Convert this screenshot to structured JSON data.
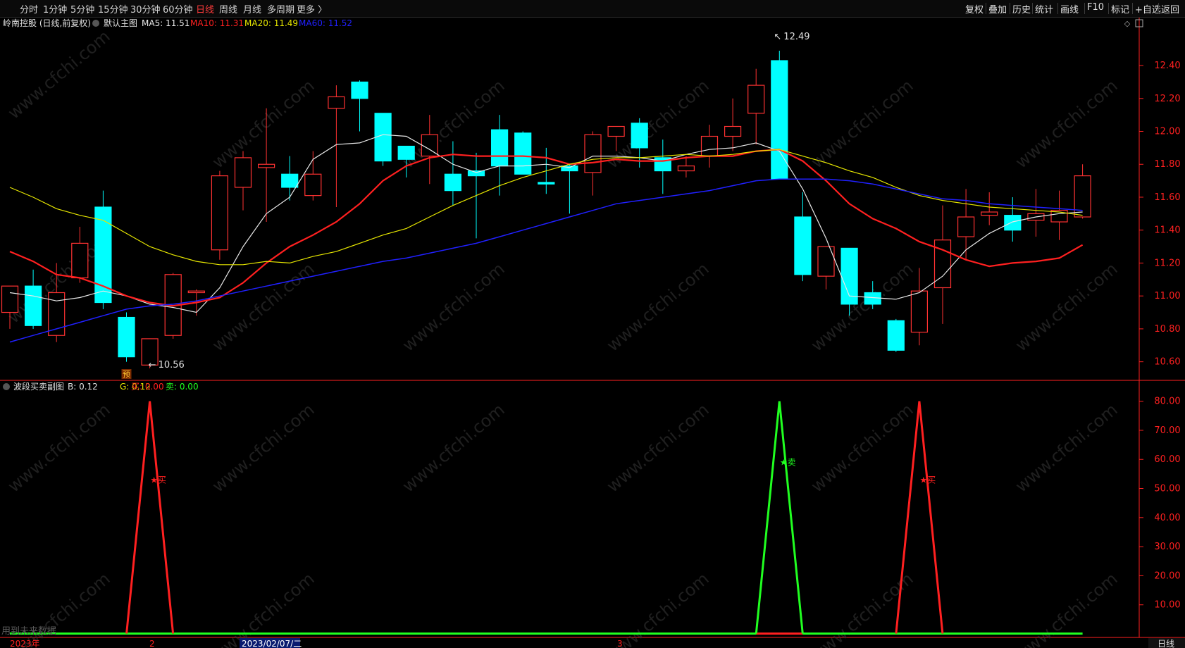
{
  "toolbar": {
    "periods": [
      "分时",
      "1分钟",
      "5分钟",
      "15分钟",
      "30分钟",
      "60分钟",
      "日线",
      "周线",
      "月线",
      "多周期",
      "更多 〉"
    ],
    "active_period": "日线",
    "actions": [
      "复权",
      "叠加",
      "历史",
      "统计",
      "画线",
      "F10",
      "标记",
      "+自选",
      "返回"
    ]
  },
  "main_legend": {
    "title": "岭南控股 (日线,前复权)",
    "indicator": "默认主图",
    "ma5_label": "MA5: 11.51",
    "ma10_label": "MA10: 11.31",
    "ma20_label": "MA20: 11.49",
    "ma60_label": "MA60: 11.52"
  },
  "sub_legend": {
    "title": "波段买卖副图",
    "b_label": "B: 0.12",
    "g_label": "G: 0.12",
    "buy_label": "买: 0.00",
    "sell_label": "卖: 0.00"
  },
  "annotations": {
    "high": "12.49",
    "low": "10.56",
    "yu_marker": "预",
    "buy_marker": "★买",
    "sell_marker": "★卖"
  },
  "xaxis": {
    "labels": [
      "2023年",
      "2",
      "2023/02/07/二",
      "3"
    ],
    "period_label": "日线"
  },
  "bottom_text": "用到未来数据",
  "watermark": "www.cfchi.com",
  "colors": {
    "up": "#ff3232",
    "down": "#00ffff",
    "ma5": "#e8e8e8",
    "ma10": "#ff2020",
    "ma20": "#e6e600",
    "ma60": "#2020ff",
    "buy": "#ff2020",
    "sell": "#20ff20",
    "axis": "#ff2020"
  },
  "chart_data": [
    {
      "type": "candlestick",
      "title": "岭南控股 (日线,前复权)",
      "ylim": [
        10.5,
        12.55
      ],
      "yticks": [
        10.6,
        10.8,
        11.0,
        11.2,
        11.4,
        11.6,
        11.8,
        12.0,
        12.2,
        12.4
      ],
      "ohlc": [
        [
          10.9,
          11.06,
          10.8,
          11.06
        ],
        [
          11.06,
          11.16,
          10.8,
          10.82
        ],
        [
          10.76,
          11.2,
          10.72,
          11.02
        ],
        [
          11.11,
          11.42,
          11.08,
          11.32
        ],
        [
          11.54,
          11.64,
          10.92,
          10.96
        ],
        [
          10.87,
          10.9,
          10.6,
          10.63
        ],
        [
          10.58,
          10.74,
          10.56,
          10.74
        ],
        [
          10.76,
          11.14,
          10.74,
          11.13
        ],
        [
          11.02,
          11.04,
          10.88,
          11.03
        ],
        [
          11.28,
          11.76,
          11.22,
          11.73
        ],
        [
          11.66,
          11.88,
          11.52,
          11.84
        ],
        [
          11.78,
          12.14,
          11.45,
          11.8
        ],
        [
          11.74,
          11.85,
          11.58,
          11.66
        ],
        [
          11.61,
          11.88,
          11.58,
          11.74
        ],
        [
          12.14,
          12.28,
          11.54,
          12.21
        ],
        [
          12.3,
          12.31,
          12.0,
          12.2
        ],
        [
          12.11,
          12.11,
          11.79,
          11.82
        ],
        [
          11.91,
          11.91,
          11.72,
          11.83
        ],
        [
          11.85,
          12.1,
          11.68,
          11.98
        ],
        [
          11.74,
          11.94,
          11.55,
          11.64
        ],
        [
          11.76,
          11.87,
          11.35,
          11.73
        ],
        [
          12.01,
          12.1,
          11.61,
          11.79
        ],
        [
          11.99,
          12.0,
          11.74,
          11.74
        ],
        [
          11.69,
          11.9,
          11.62,
          11.68
        ],
        [
          11.79,
          11.8,
          11.5,
          11.76
        ],
        [
          11.75,
          12.0,
          11.61,
          11.98
        ],
        [
          11.97,
          12.03,
          11.88,
          12.03
        ],
        [
          12.05,
          12.08,
          11.78,
          11.9
        ],
        [
          11.84,
          11.95,
          11.62,
          11.76
        ],
        [
          11.76,
          11.85,
          11.72,
          11.79
        ],
        [
          11.85,
          12.04,
          11.78,
          11.97
        ],
        [
          11.97,
          12.2,
          11.88,
          12.03
        ],
        [
          12.11,
          12.38,
          11.92,
          12.28
        ],
        [
          12.43,
          12.49,
          11.71,
          11.71
        ],
        [
          11.48,
          11.63,
          11.09,
          11.13
        ],
        [
          11.12,
          11.3,
          11.04,
          11.3
        ],
        [
          11.29,
          11.29,
          10.88,
          10.95
        ],
        [
          11.02,
          11.09,
          10.92,
          10.95
        ],
        [
          10.85,
          10.86,
          10.66,
          10.67
        ],
        [
          10.78,
          11.17,
          10.7,
          11.03
        ],
        [
          11.05,
          11.55,
          10.83,
          11.34
        ],
        [
          11.36,
          11.65,
          11.22,
          11.48
        ],
        [
          11.49,
          11.63,
          11.43,
          11.51
        ],
        [
          11.49,
          11.6,
          11.33,
          11.4
        ],
        [
          11.46,
          11.65,
          11.36,
          11.5
        ],
        [
          11.45,
          11.64,
          11.34,
          11.52
        ],
        [
          11.48,
          11.8,
          11.47,
          11.73
        ]
      ],
      "series": [
        {
          "name": "MA5",
          "values": [
            11.02,
            11.0,
            10.97,
            10.99,
            11.03,
            11.0,
            10.95,
            10.93,
            10.9,
            11.05,
            11.3,
            11.5,
            11.6,
            11.83,
            11.92,
            11.93,
            11.98,
            11.97,
            11.89,
            11.8,
            11.75,
            11.79,
            11.79,
            11.8,
            11.78,
            11.85,
            11.85,
            11.84,
            11.82,
            11.86,
            11.89,
            11.9,
            11.93,
            11.88,
            11.65,
            11.35,
            11.0,
            10.99,
            10.98,
            11.02,
            11.12,
            11.28,
            11.38,
            11.45,
            11.48,
            11.5,
            11.51
          ]
        },
        {
          "name": "MA10",
          "values": [
            11.27,
            11.21,
            11.13,
            11.11,
            11.06,
            11.0,
            10.96,
            10.94,
            10.96,
            10.99,
            11.08,
            11.2,
            11.3,
            11.37,
            11.45,
            11.56,
            11.7,
            11.79,
            11.84,
            11.86,
            11.85,
            11.85,
            11.85,
            11.84,
            11.8,
            11.81,
            11.83,
            11.82,
            11.82,
            11.84,
            11.85,
            11.85,
            11.88,
            11.89,
            11.82,
            11.7,
            11.56,
            11.47,
            11.41,
            11.33,
            11.28,
            11.22,
            11.18,
            11.2,
            11.21,
            11.23,
            11.31
          ]
        },
        {
          "name": "MA20",
          "values": [
            11.66,
            11.6,
            11.53,
            11.49,
            11.46,
            11.38,
            11.3,
            11.25,
            11.21,
            11.19,
            11.19,
            11.21,
            11.2,
            11.24,
            11.27,
            11.32,
            11.37,
            11.41,
            11.48,
            11.55,
            11.61,
            11.67,
            11.72,
            11.76,
            11.8,
            11.83,
            11.84,
            11.84,
            11.85,
            11.86,
            11.85,
            11.86,
            11.88,
            11.89,
            11.85,
            11.81,
            11.76,
            11.72,
            11.66,
            11.61,
            11.58,
            11.56,
            11.54,
            11.53,
            11.52,
            11.51,
            11.49
          ]
        },
        {
          "name": "MA60",
          "values": [
            10.72,
            10.76,
            10.8,
            10.84,
            10.88,
            10.92,
            10.94,
            10.95,
            10.97,
            11.0,
            11.03,
            11.06,
            11.09,
            11.12,
            11.15,
            11.18,
            11.21,
            11.23,
            11.26,
            11.29,
            11.32,
            11.36,
            11.4,
            11.44,
            11.48,
            11.52,
            11.56,
            11.58,
            11.6,
            11.62,
            11.64,
            11.67,
            11.7,
            11.71,
            11.71,
            11.71,
            11.7,
            11.68,
            11.65,
            11.62,
            11.59,
            11.58,
            11.56,
            11.55,
            11.54,
            11.53,
            11.52
          ]
        }
      ]
    },
    {
      "type": "line",
      "title": "波段买卖副图",
      "ylim": [
        0,
        85
      ],
      "yticks": [
        10,
        20,
        30,
        40,
        50,
        60,
        70,
        80
      ],
      "series": [
        {
          "name": "B",
          "values": [
            0.12,
            0.12,
            0.12,
            0.12,
            0.12,
            0.12,
            80,
            0.12,
            0.12,
            0.12,
            0.12,
            0.12,
            0.12,
            0.12,
            0.12,
            0.12,
            0.12,
            0.12,
            0.12,
            0.12,
            0.12,
            0.12,
            0.12,
            0.12,
            0.12,
            0.12,
            0.12,
            0.12,
            0.12,
            0.12,
            0.12,
            0.12,
            0.12,
            0.12,
            0.12,
            0.12,
            0.12,
            0.12,
            0.12,
            80,
            0.12,
            0.12,
            0.12,
            0.12,
            0.12,
            0.12,
            0.12
          ]
        },
        {
          "name": "G",
          "values": [
            0.12,
            0.12,
            0.12,
            0.12,
            0.12,
            0.12,
            0.12,
            0.12,
            0.12,
            0.12,
            0.12,
            0.12,
            0.12,
            0.12,
            0.12,
            0.12,
            0.12,
            0.12,
            0.12,
            0.12,
            0.12,
            0.12,
            0.12,
            0.12,
            0.12,
            0.12,
            0.12,
            0.12,
            0.12,
            0.12,
            0.12,
            0.12,
            0.12,
            80,
            0.12,
            0.12,
            0.12,
            0.12,
            0.12,
            0.12,
            0.12,
            0.12,
            0.12,
            0.12,
            0.12,
            0.12,
            0.12
          ]
        }
      ]
    }
  ]
}
